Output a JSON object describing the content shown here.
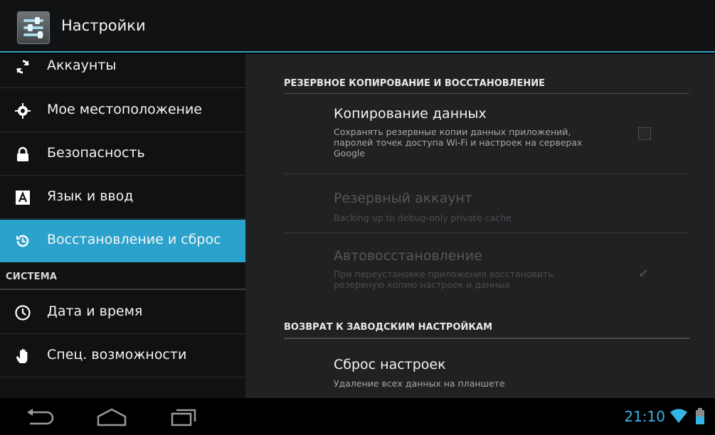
{
  "action_bar": {
    "title": "Настройки",
    "app_icon": "settings-app-icon"
  },
  "sidebar": {
    "items": [
      {
        "icon": "sync-icon",
        "label": "Аккаунты"
      },
      {
        "icon": "location-icon",
        "label": "Мое местоположение"
      },
      {
        "icon": "lock-icon",
        "label": "Безопасность"
      },
      {
        "icon": "language-icon",
        "label": "Язык и ввод"
      },
      {
        "icon": "restore-icon",
        "label": "Восстановление и сброс",
        "active": true
      }
    ],
    "section_system": "СИСТЕМА",
    "system_items": [
      {
        "icon": "clock-icon",
        "label": "Дата и время"
      },
      {
        "icon": "hand-icon",
        "label": "Спец. возможности"
      }
    ]
  },
  "main": {
    "section_backup": "РЕЗЕРВНОЕ КОПИРОВАНИЕ И ВОССТАНОВЛЕНИЕ",
    "backup_data": {
      "title": "Копирование данных",
      "summary": "Сохранять резервные копии данных приложений, паролей точек доступа Wi-Fi и настроек на серверах Google",
      "checked": false
    },
    "backup_account": {
      "title": "Резервный аккаунт",
      "summary": "Backing up to debug-only private cache",
      "enabled": false
    },
    "auto_restore": {
      "title": "Автовосстановление",
      "summary": "При переустановке приложения восстановить резервную копию настроек и данных",
      "checked": true,
      "enabled": false
    },
    "section_factory": "ВОЗВРАТ К ЗАВОДСКИМ НАСТРОЙКАМ",
    "factory_reset": {
      "title": "Сброс настроек",
      "summary": "Удаление всех данных на планшете"
    }
  },
  "system_bar": {
    "clock": "21:10",
    "accent": "#33b5e5"
  }
}
